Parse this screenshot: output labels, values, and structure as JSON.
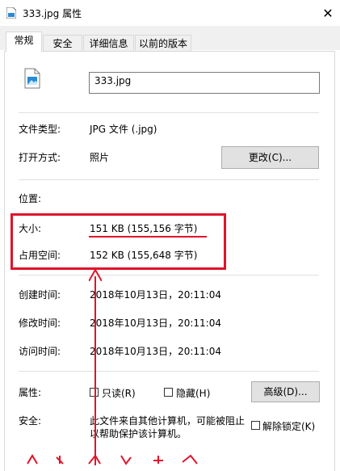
{
  "window": {
    "title": "333.jpg 属性",
    "close_glyph": "✕"
  },
  "tabs": [
    {
      "label": "常规",
      "active": true
    },
    {
      "label": "安全",
      "active": false
    },
    {
      "label": "详细信息",
      "active": false
    },
    {
      "label": "以前的版本",
      "active": false
    }
  ],
  "general": {
    "filename": "333.jpg",
    "type_label": "文件类型:",
    "type_value": "JPG 文件 (.jpg)",
    "opens_with_label": "打开方式:",
    "opens_with_value": "照片",
    "change_button": "更改(C)...",
    "location_label": "位置:",
    "size_label": "大小:",
    "size_value": "151 KB (155,156 字节)",
    "size_on_disk_label": "占用空间:",
    "size_on_disk_value": "152 KB (155,648 字节)",
    "created_label": "创建时间:",
    "created_value": "2018年10月13日，20:11:04",
    "modified_label": "修改时间:",
    "modified_value": "2018年10月13日，20:11:04",
    "accessed_label": "访问时间:",
    "accessed_value": "2018年10月13日，20:11:04",
    "attributes_label": "属性:",
    "readonly_label": "只读(R)",
    "hidden_label": "隐藏(H)",
    "advanced_button": "高级(D)...",
    "security_label": "安全:",
    "security_text_line1": "此文件来自其他计算机，可能被阻止",
    "security_text_line2": "以帮助保护该计算机。",
    "unblock_label": "解除锁定(K)"
  },
  "colors": {
    "annotation": "#e0142a",
    "button_bg": "#e1e1e1",
    "tab_bg": "#f0f0f0"
  }
}
